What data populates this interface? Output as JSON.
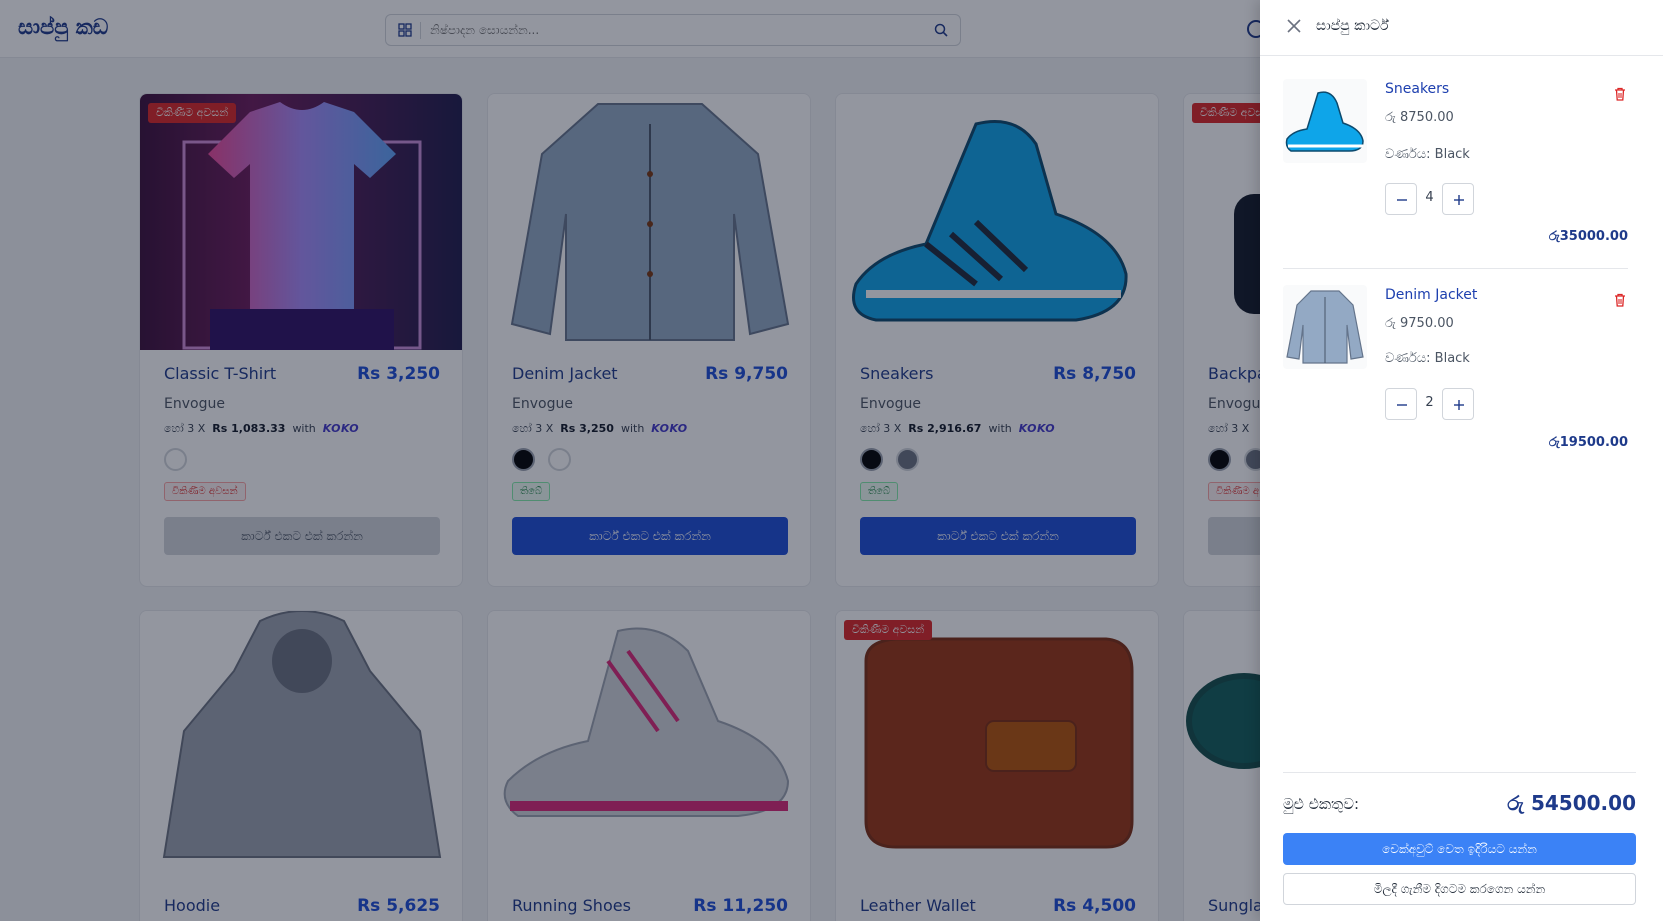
{
  "header": {
    "logo": "සාප්පු කඩ",
    "search_placeholder": "නිෂ්පාදන සොයන්න..."
  },
  "products": [
    {
      "name": "Classic T-Shirt",
      "price": "Rs 3,250",
      "brand": "Envogue",
      "installment_prefix": "හෝ 3 X",
      "installment": "Rs 1,083.33",
      "with": "with",
      "koko": "KOKO",
      "badge": "විකිණීම අවසන්",
      "stock": "විකිණීම අවසන්",
      "button": "කාර්ට් එකට එක් කරන්න"
    },
    {
      "name": "Denim Jacket",
      "price": "Rs 9,750",
      "brand": "Envogue",
      "installment_prefix": "හෝ 3 X",
      "installment": "Rs 3,250",
      "with": "with",
      "koko": "KOKO",
      "stock": "තිබේ",
      "button": "කාර්ට් එකට එක් කරන්න"
    },
    {
      "name": "Sneakers",
      "price": "Rs 8,750",
      "brand": "Envogue",
      "installment_prefix": "හෝ 3 X",
      "installment": "Rs 2,916.67",
      "with": "with",
      "koko": "KOKO",
      "stock": "තිබේ",
      "button": "කාර්ට් එකට එක් කරන්න"
    },
    {
      "name": "Backpa",
      "brand": "Envogue",
      "installment_prefix": "හෝ 3 X",
      "badge": "විකිණීම අවසන්",
      "stock": "විකිණීම අ"
    },
    {
      "name": "Hoodie",
      "price": "Rs 5,625"
    },
    {
      "name": "Running Shoes",
      "price": "Rs 11,250"
    },
    {
      "name": "Leather Wallet",
      "price": "Rs 4,500",
      "badge": "විකිණීම අවසන්"
    },
    {
      "name": "Sungla"
    }
  ],
  "cart": {
    "title": "සාප්පු කාර්ට්",
    "items": [
      {
        "name": "Sneakers",
        "unit_price": "රු 8750.00",
        "variant": "වර්ණය: Black",
        "qty": "4",
        "line_total": "රු35000.00"
      },
      {
        "name": "Denim Jacket",
        "unit_price": "රු 9750.00",
        "variant": "වර්ණය: Black",
        "qty": "2",
        "line_total": "රු19500.00"
      }
    ],
    "total_label": "මුළු එකතුව:",
    "total_value": "රු 54500.00",
    "checkout": "චෙක්අවුට් වෙත ඉදිරියට යන්න",
    "continue": "මිලදී ගැනීම දිගටම කරගෙන යන්න"
  },
  "colors": {
    "brand": "#1e3a8a",
    "accent": "#1d4ed8",
    "sold_out": "#dc2626",
    "in_stock": "#15803d",
    "checkout": "#3b82f6"
  }
}
